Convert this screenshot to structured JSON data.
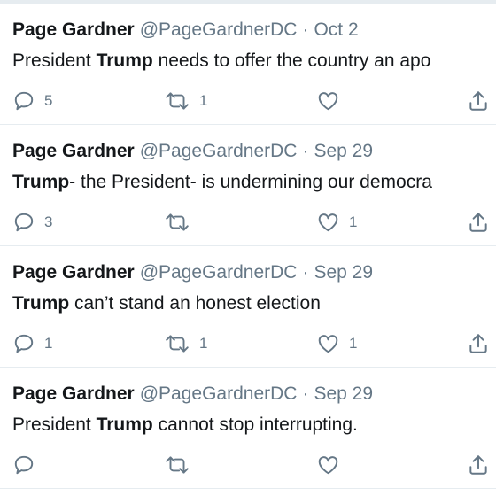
{
  "tweets": [
    {
      "name": "Page Gardner",
      "handle": "@PageGardnerDC",
      "separator": "·",
      "date": "Oct 2",
      "text_pre": "President ",
      "text_bold": "Trump",
      "text_post": " needs to offer the country an apo",
      "replies": "5",
      "retweets": "1",
      "likes": ""
    },
    {
      "name": "Page Gardner",
      "handle": "@PageGardnerDC",
      "separator": "·",
      "date": "Sep 29",
      "text_pre": "",
      "text_bold": "Trump",
      "text_post": "- the President- is undermining our democra",
      "replies": "3",
      "retweets": "",
      "likes": "1"
    },
    {
      "name": "Page Gardner",
      "handle": "@PageGardnerDC",
      "separator": "·",
      "date": "Sep 29",
      "text_pre": "",
      "text_bold": "Trump",
      "text_post": " can’t stand an honest election",
      "replies": "1",
      "retweets": "1",
      "likes": "1"
    },
    {
      "name": "Page Gardner",
      "handle": "@PageGardnerDC",
      "separator": "·",
      "date": "Sep 29",
      "text_pre": "President ",
      "text_bold": "Trump",
      "text_post": " cannot stop interrupting.",
      "replies": "",
      "retweets": "",
      "likes": ""
    }
  ],
  "icons": {
    "reply": "reply-icon",
    "retweet": "retweet-icon",
    "like": "heart-icon",
    "share": "share-icon"
  },
  "colors": {
    "text": "#14171a",
    "secondary": "#657786",
    "divider": "#e6ecf0"
  }
}
